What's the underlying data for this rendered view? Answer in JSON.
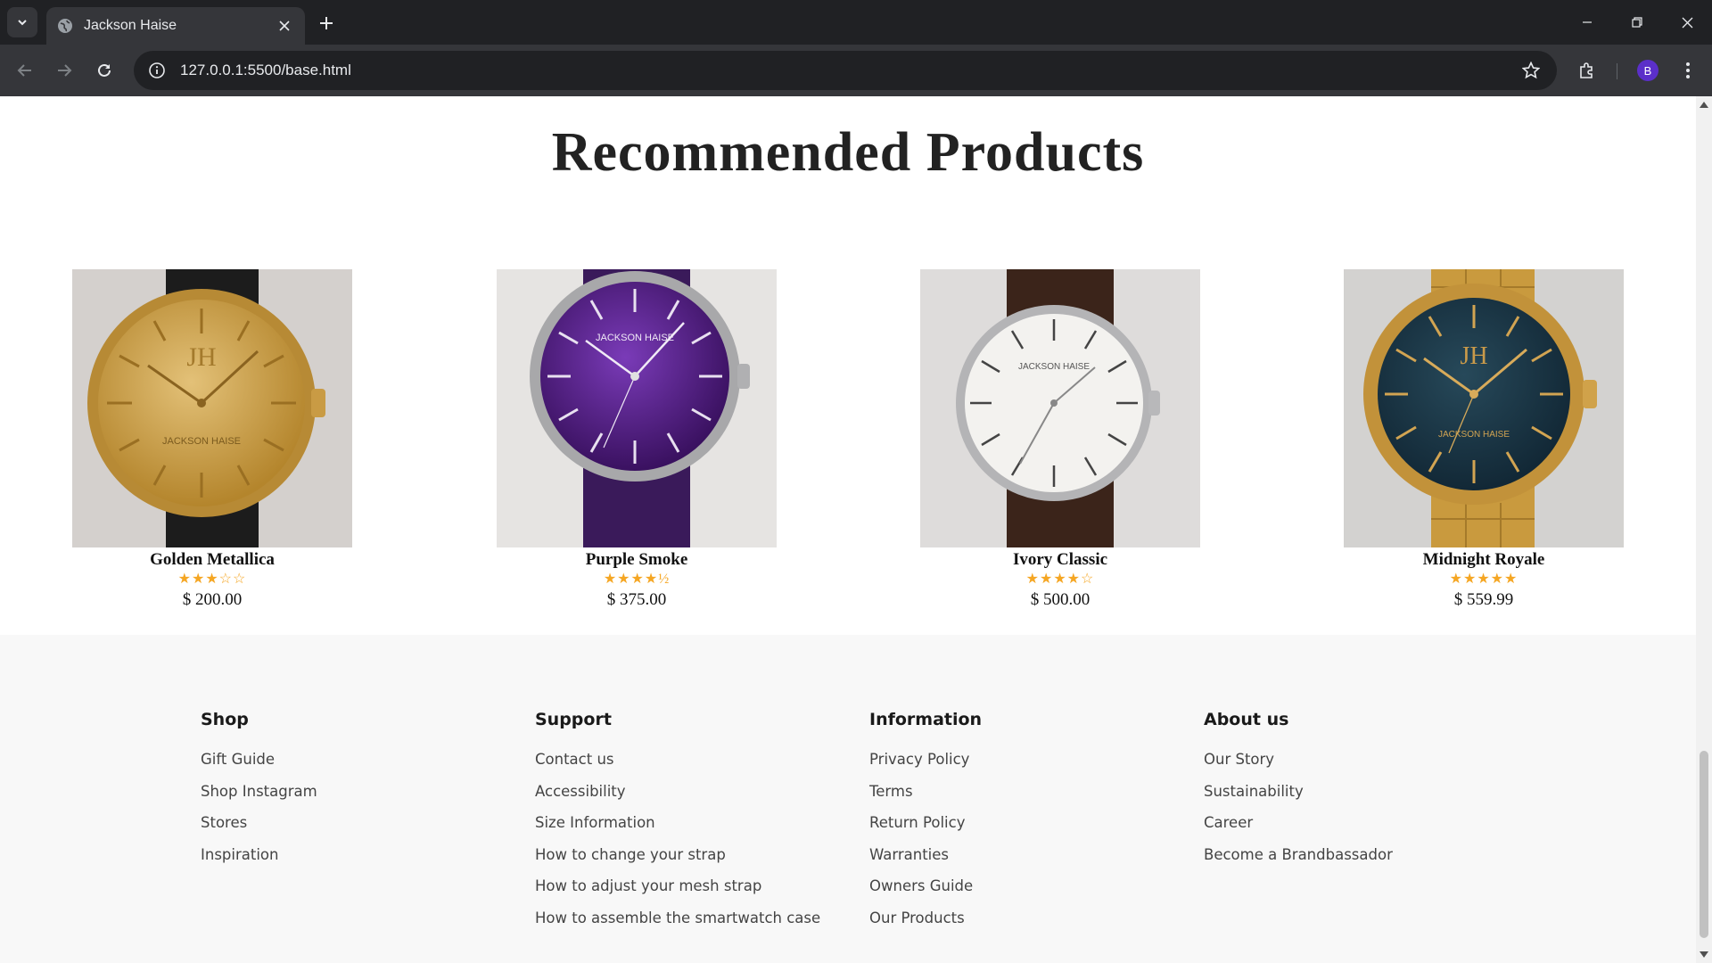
{
  "browser": {
    "tab_title": "Jackson Haise",
    "url": "127.0.0.1:5500/base.html",
    "profile_initial": "B"
  },
  "page": {
    "section_title": "Recommended Products",
    "currency_symbol": "$",
    "rating_color": "#f5a623",
    "products": [
      {
        "name": "Golden Metallica",
        "rating": 3,
        "rating_display": "★★★☆☆",
        "price": "$ 200.00",
        "dial_color": "#c9a24a",
        "strap": "black-leather",
        "brand_text": "JACKSON HAISE",
        "monogram": "JH"
      },
      {
        "name": "Purple Smoke",
        "rating": 4.5,
        "rating_display": "★★★★½",
        "price": "$ 375.00",
        "dial_color": "#4b1d7a",
        "strap": "purple-leather",
        "brand_text": "JACKSON HAISE",
        "monogram": ""
      },
      {
        "name": "Ivory Classic",
        "rating": 4,
        "rating_display": "★★★★☆",
        "price": "$ 500.00",
        "dial_color": "#f2f2f0",
        "strap": "brown-leather",
        "brand_text": "JACKSON HAISE",
        "monogram": ""
      },
      {
        "name": "Midnight Royale",
        "rating": 5,
        "rating_display": "★★★★★",
        "price": "$ 559.99",
        "dial_color": "#1f3a4a",
        "strap": "gold-bracelet",
        "brand_text": "JACKSON HAISE",
        "monogram": "JH"
      }
    ]
  },
  "footer": {
    "columns": [
      {
        "heading": "Shop",
        "links": [
          "Gift Guide",
          "Shop Instagram",
          "Stores",
          "Inspiration"
        ]
      },
      {
        "heading": "Support",
        "links": [
          "Contact us",
          "Accessibility",
          "Size Information",
          "How to change your strap",
          "How to adjust your mesh strap",
          "How to assemble the smartwatch case"
        ]
      },
      {
        "heading": "Information",
        "links": [
          "Privacy Policy",
          "Terms",
          "Return Policy",
          "Warranties",
          "Owners Guide",
          "Our Products"
        ]
      },
      {
        "heading": "About us",
        "links": [
          "Our Story",
          "Sustainability",
          "Career",
          "Become a Brandbassador"
        ]
      }
    ]
  }
}
